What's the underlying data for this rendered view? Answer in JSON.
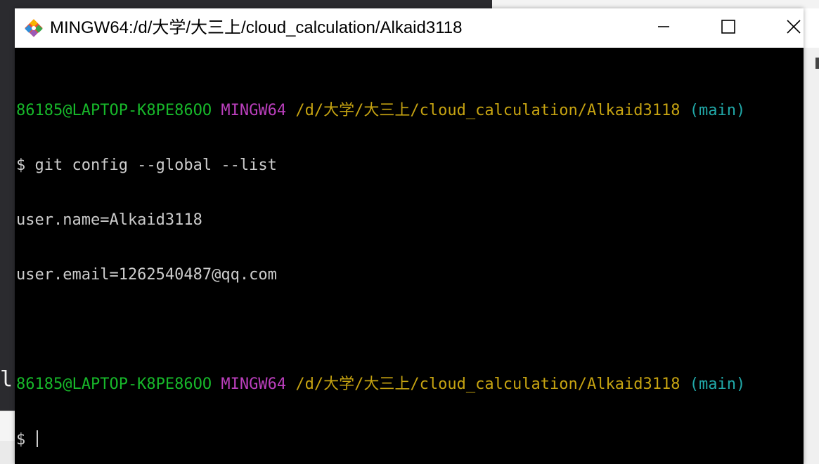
{
  "window": {
    "title": "MINGW64:/d/大学/大三上/cloud_calculation/Alkaid3118",
    "icon": "git-bash-icon",
    "controls": {
      "minimize": "minimize-icon",
      "maximize": "maximize-icon",
      "close": "close-icon"
    }
  },
  "terminal": {
    "prompt1": {
      "user": "86185@LAPTOP-K8PE86OO",
      "system": "MINGW64",
      "path": "/d/大学/大三上/cloud_calculation/Alkaid3118",
      "branch": "(main)"
    },
    "command": "$ git config --global --list",
    "output": [
      "user.name=Alkaid3118",
      "user.email=1262540487@qq.com"
    ],
    "prompt2": {
      "user": "86185@LAPTOP-K8PE86OO",
      "system": "MINGW64",
      "path": "/d/大学/大三上/cloud_calculation/Alkaid3118",
      "branch": "(main)"
    },
    "current_prompt": "$ "
  },
  "background": {
    "left_glyph": "l"
  },
  "colors": {
    "user": "#17b82a",
    "system": "#bb3fbd",
    "path": "#c6a311",
    "branch": "#21a9a9",
    "text": "#cccccc",
    "terminal_bg": "#000000"
  }
}
